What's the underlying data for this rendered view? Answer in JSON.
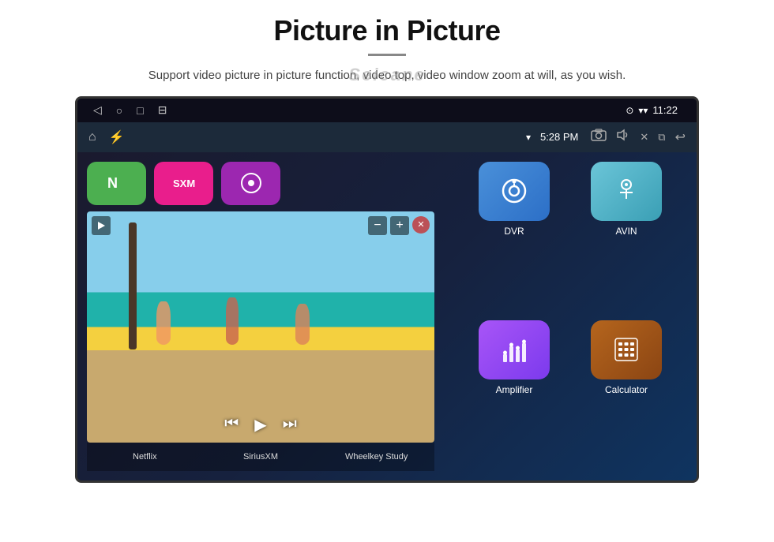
{
  "page": {
    "title": "Picture in Picture",
    "watermark": "Seicane",
    "subtitle": "Support video picture in picture function, video top, video window zoom at will, as you wish."
  },
  "status_bar": {
    "time": "11:22",
    "nav_back": "◁",
    "nav_home": "○",
    "nav_recents": "□",
    "nav_screenshot": "⊟"
  },
  "action_bar": {
    "home_icon": "⌂",
    "usb_icon": "⚡",
    "wifi_icon": "▾",
    "time": "5:28 PM",
    "camera_icon": "📷",
    "volume_icon": "🔊",
    "close_icon": "✕",
    "window_icon": "⧉",
    "back_icon": "↩"
  },
  "pip": {
    "minimize_label": "−",
    "expand_label": "+",
    "close_label": "✕"
  },
  "media_controls": {
    "prev": "⏮",
    "play": "▶",
    "next": "⏭"
  },
  "top_apps": [
    {
      "id": "netflix",
      "color_class": "top-app-green",
      "label": "Netflix"
    },
    {
      "id": "siriusxm",
      "color_class": "top-app-pink",
      "label": "SiriusXM"
    },
    {
      "id": "wheelkey",
      "color_class": "top-app-purple",
      "label": "Wheelkey Study"
    }
  ],
  "bottom_labels": [
    "Netflix",
    "SiriusXM",
    "Wheelkey Study"
  ],
  "apps": [
    {
      "id": "dvr",
      "label": "DVR",
      "color_class": "app-dvr",
      "icon": "dvr"
    },
    {
      "id": "avin",
      "label": "AVIN",
      "color_class": "app-avin",
      "icon": "avin"
    },
    {
      "id": "amplifier",
      "label": "Amplifier",
      "color_class": "app-amplifier",
      "icon": "amplifier"
    },
    {
      "id": "calculator",
      "label": "Calculator",
      "color_class": "app-calculator",
      "icon": "calculator"
    }
  ]
}
